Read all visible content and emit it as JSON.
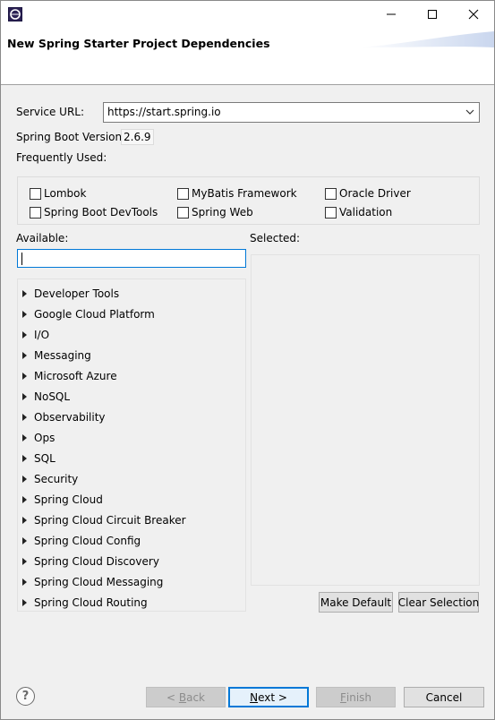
{
  "window": {
    "header_title": "New Spring Starter Project Dependencies"
  },
  "service_url": {
    "label": "Service URL:",
    "value": "https://start.spring.io"
  },
  "boot_version": {
    "label": "Spring Boot Version:",
    "value": "2.6.9"
  },
  "frequently_used": {
    "label": "Frequently Used:",
    "items": [
      {
        "label": "Lombok",
        "checked": false
      },
      {
        "label": "MyBatis Framework",
        "checked": false
      },
      {
        "label": "Oracle Driver",
        "checked": false
      },
      {
        "label": "Spring Boot DevTools",
        "checked": false
      },
      {
        "label": "Spring Web",
        "checked": false
      },
      {
        "label": "Validation",
        "checked": false
      }
    ]
  },
  "available": {
    "label": "Available:",
    "search_value": "",
    "categories": [
      "Developer Tools",
      "Google Cloud Platform",
      "I/O",
      "Messaging",
      "Microsoft Azure",
      "NoSQL",
      "Observability",
      "Ops",
      "SQL",
      "Security",
      "Spring Cloud",
      "Spring Cloud Circuit Breaker",
      "Spring Cloud Config",
      "Spring Cloud Discovery",
      "Spring Cloud Messaging",
      "Spring Cloud Routing"
    ]
  },
  "selected": {
    "label": "Selected:"
  },
  "buttons": {
    "make_default": "Make Default",
    "clear_selection": "Clear Selection",
    "back_prefix": "< ",
    "back_mnemonic": "B",
    "back_rest": "ack",
    "next_mnemonic": "N",
    "next_rest": "ext >",
    "finish_mnemonic": "F",
    "finish_rest": "inish",
    "cancel": "Cancel"
  },
  "icons": {
    "app": "eclipse-icon",
    "minimize": "minimize-icon",
    "maximize": "maximize-icon",
    "close": "close-icon",
    "dropdown": "chevron-down-icon",
    "help": "help-icon",
    "tree": "chevron-right-icon"
  },
  "colors": {
    "accent": "#0078d7",
    "window_bg": "#f0f0f0"
  }
}
